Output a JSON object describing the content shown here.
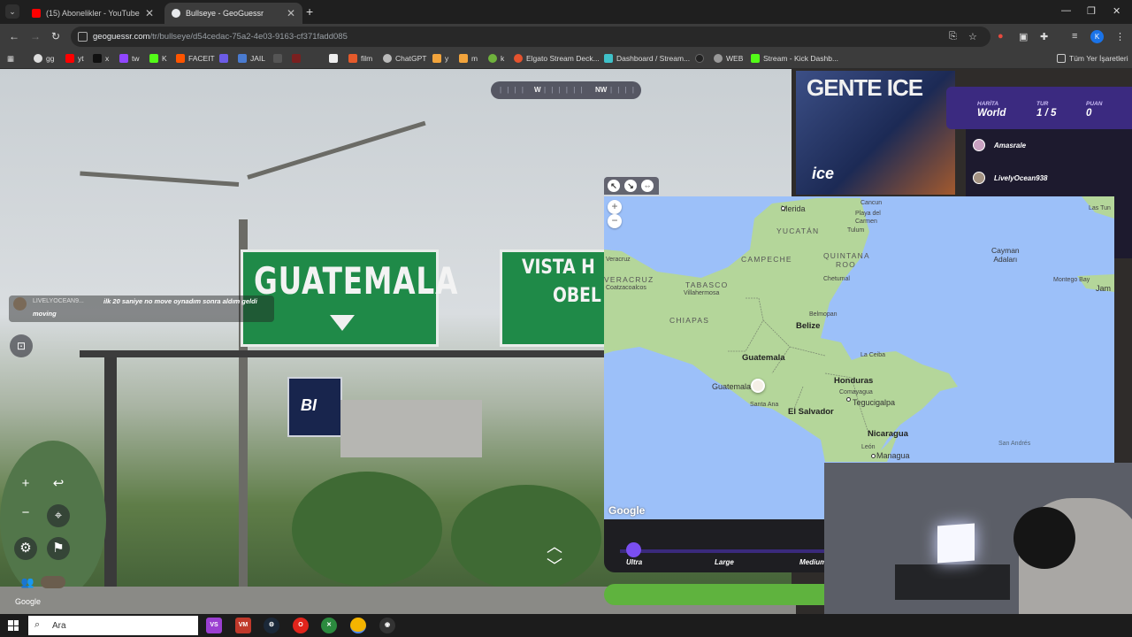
{
  "browser": {
    "tabs": [
      {
        "title": "(15) Abonelikler - YouTube",
        "active": false
      },
      {
        "title": "Bullseye - GeoGuessr",
        "active": true
      }
    ],
    "url_host": "geoguessr.com",
    "url_path": "/tr/bullseye/d54cedac-75a2-4e03-9163-cf371fadd085",
    "bookmarks": [
      "gg",
      "yt",
      "x",
      "tw",
      "K",
      "FACEIT",
      "JAIL",
      "film",
      "ChatGPT",
      "y",
      "m",
      "k",
      "Elgato Stream Deck...",
      "Dashboard / Stream...",
      "WEB",
      "Stream - Kick Dashb..."
    ],
    "bookmarks_folder": "Tüm Yer İşaretleri",
    "profile_initial": "K",
    "ext_badge": "1"
  },
  "scene": {
    "sign_main": "GUATEMALA",
    "sign_second_line1": "VISTA H",
    "sign_second_line2": "OBEL",
    "bi_logo": "BI",
    "billboard_text": "GENTE ICE",
    "billboard_sub": "ice",
    "google_watermark": "Google"
  },
  "compass": {
    "left_dir": "W",
    "right_dir": "NW"
  },
  "chat": {
    "user": "LIVELYOCEAN9...",
    "message": "ilk 20 saniye no move oynadım sonra aldım geldi",
    "message_cont": "moving"
  },
  "hud": {
    "map_label": "HARİTA",
    "map_value": "World",
    "round_label": "TUR",
    "round_value": "1 / 5",
    "score_label": "PUAN",
    "score_value": "0"
  },
  "players": [
    "Amasrale",
    "LivelyOcean938"
  ],
  "map": {
    "google_label": "Google",
    "countries": [
      "Guatemala",
      "Belize",
      "Honduras",
      "El Salvador",
      "Nicaragua"
    ],
    "regions": [
      "YUCATÁN",
      "CAMPECHE",
      "QUINTANA",
      "ROO",
      "TABASCO",
      "VERACRUZ",
      "CHIAPAS"
    ],
    "cities": [
      "Merida",
      "Cancun",
      "Playa del",
      "Carmen",
      "Tulum",
      "Chetumal",
      "Belmopan",
      "Villahermosa",
      "Coatzacoalcos",
      "Veracruz",
      "La Ceiba",
      "Comayagua",
      "Tegucigalpa",
      "Santa Ana",
      "León",
      "Managua",
      "Guatemala",
      "Montego Bay",
      "Jam",
      "Las Tun",
      "San Andrés"
    ],
    "sea_label_1": "Cayman",
    "sea_label_2": "Adaları"
  },
  "map_size": {
    "options": [
      "Ultra",
      "Large",
      "Medium"
    ],
    "selected": "Ultra"
  },
  "taskbar": {
    "search_placeholder": "Ara"
  },
  "colors": {
    "hud_purple": "#3b2a80",
    "guess_green": "#5fb33e",
    "map_water": "#9cc0f9",
    "map_land": "#b4d69a",
    "sign_green": "#1f8a48"
  }
}
